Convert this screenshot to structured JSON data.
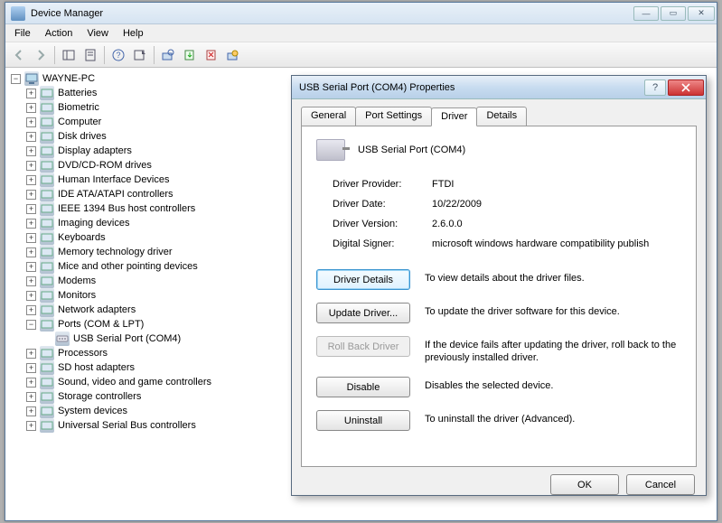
{
  "window": {
    "title": "Device Manager",
    "menus": [
      "File",
      "Action",
      "View",
      "Help"
    ]
  },
  "tree": {
    "root": "WAYNE-PC",
    "nodes": [
      {
        "label": "Batteries"
      },
      {
        "label": "Biometric"
      },
      {
        "label": "Computer"
      },
      {
        "label": "Disk drives"
      },
      {
        "label": "Display adapters"
      },
      {
        "label": "DVD/CD-ROM drives"
      },
      {
        "label": "Human Interface Devices"
      },
      {
        "label": "IDE ATA/ATAPI controllers"
      },
      {
        "label": "IEEE 1394 Bus host controllers"
      },
      {
        "label": "Imaging devices"
      },
      {
        "label": "Keyboards"
      },
      {
        "label": "Memory technology driver"
      },
      {
        "label": "Mice and other pointing devices"
      },
      {
        "label": "Modems"
      },
      {
        "label": "Monitors"
      },
      {
        "label": "Network adapters"
      },
      {
        "label": "Ports (COM & LPT)",
        "expanded": true,
        "children": [
          {
            "label": "USB Serial Port (COM4)"
          }
        ]
      },
      {
        "label": "Processors"
      },
      {
        "label": "SD host adapters"
      },
      {
        "label": "Sound, video and game controllers"
      },
      {
        "label": "Storage controllers"
      },
      {
        "label": "System devices"
      },
      {
        "label": "Universal Serial Bus controllers"
      }
    ]
  },
  "dialog": {
    "title": "USB Serial Port (COM4) Properties",
    "tabs": [
      "General",
      "Port Settings",
      "Driver",
      "Details"
    ],
    "active_tab": "Driver",
    "device_name": "USB Serial Port (COM4)",
    "info": {
      "provider_label": "Driver Provider:",
      "provider": "FTDI",
      "date_label": "Driver Date:",
      "date": "10/22/2009",
      "version_label": "Driver Version:",
      "version": "2.6.0.0",
      "signer_label": "Digital Signer:",
      "signer": "microsoft windows hardware compatibility publish"
    },
    "actions": {
      "details": {
        "label": "Driver Details",
        "desc": "To view details about the driver files."
      },
      "update": {
        "label": "Update Driver...",
        "desc": "To update the driver software for this device."
      },
      "rollback": {
        "label": "Roll Back Driver",
        "desc": "If the device fails after updating the driver, roll back to the previously installed driver."
      },
      "disable": {
        "label": "Disable",
        "desc": "Disables the selected device."
      },
      "uninstall": {
        "label": "Uninstall",
        "desc": "To uninstall the driver (Advanced)."
      }
    },
    "buttons": {
      "ok": "OK",
      "cancel": "Cancel"
    }
  }
}
